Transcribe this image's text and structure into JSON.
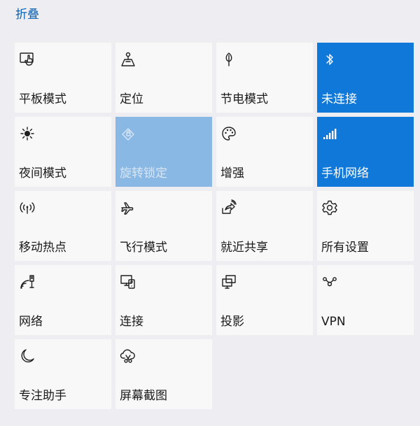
{
  "panel": {
    "collapse_label": "折叠"
  },
  "tiles": [
    {
      "label": "平板模式",
      "icon": "tablet-mode-icon",
      "state": "off"
    },
    {
      "label": "定位",
      "icon": "location-icon",
      "state": "off"
    },
    {
      "label": "节电模式",
      "icon": "battery-saver-icon",
      "state": "off"
    },
    {
      "label": "未连接",
      "icon": "bluetooth-icon",
      "state": "on"
    },
    {
      "label": "夜间模式",
      "icon": "night-light-icon",
      "state": "off"
    },
    {
      "label": "旋转锁定",
      "icon": "rotation-lock-icon",
      "state": "disabled"
    },
    {
      "label": "增强",
      "icon": "palette-icon",
      "state": "off"
    },
    {
      "label": "手机网络",
      "icon": "cellular-signal-icon",
      "state": "on"
    },
    {
      "label": "移动热点",
      "icon": "hotspot-icon",
      "state": "off"
    },
    {
      "label": "飞行模式",
      "icon": "airplane-icon",
      "state": "off"
    },
    {
      "label": "就近共享",
      "icon": "nearby-share-icon",
      "state": "off"
    },
    {
      "label": "所有设置",
      "icon": "gear-icon",
      "state": "off"
    },
    {
      "label": "网络",
      "icon": "network-icon",
      "state": "off"
    },
    {
      "label": "连接",
      "icon": "connect-icon",
      "state": "off"
    },
    {
      "label": "投影",
      "icon": "project-icon",
      "state": "off"
    },
    {
      "label": "VPN",
      "icon": "vpn-icon",
      "state": "off"
    },
    {
      "label": "专注助手",
      "icon": "moon-icon",
      "state": "off"
    },
    {
      "label": "屏幕截图",
      "icon": "screen-snip-icon",
      "state": "off"
    }
  ],
  "colors": {
    "background": "#eeedf1",
    "tile": "#f8f8f9",
    "tile_active": "#0f78d8",
    "tile_disabled": "#8ab8e4",
    "link": "#0a62b6"
  }
}
